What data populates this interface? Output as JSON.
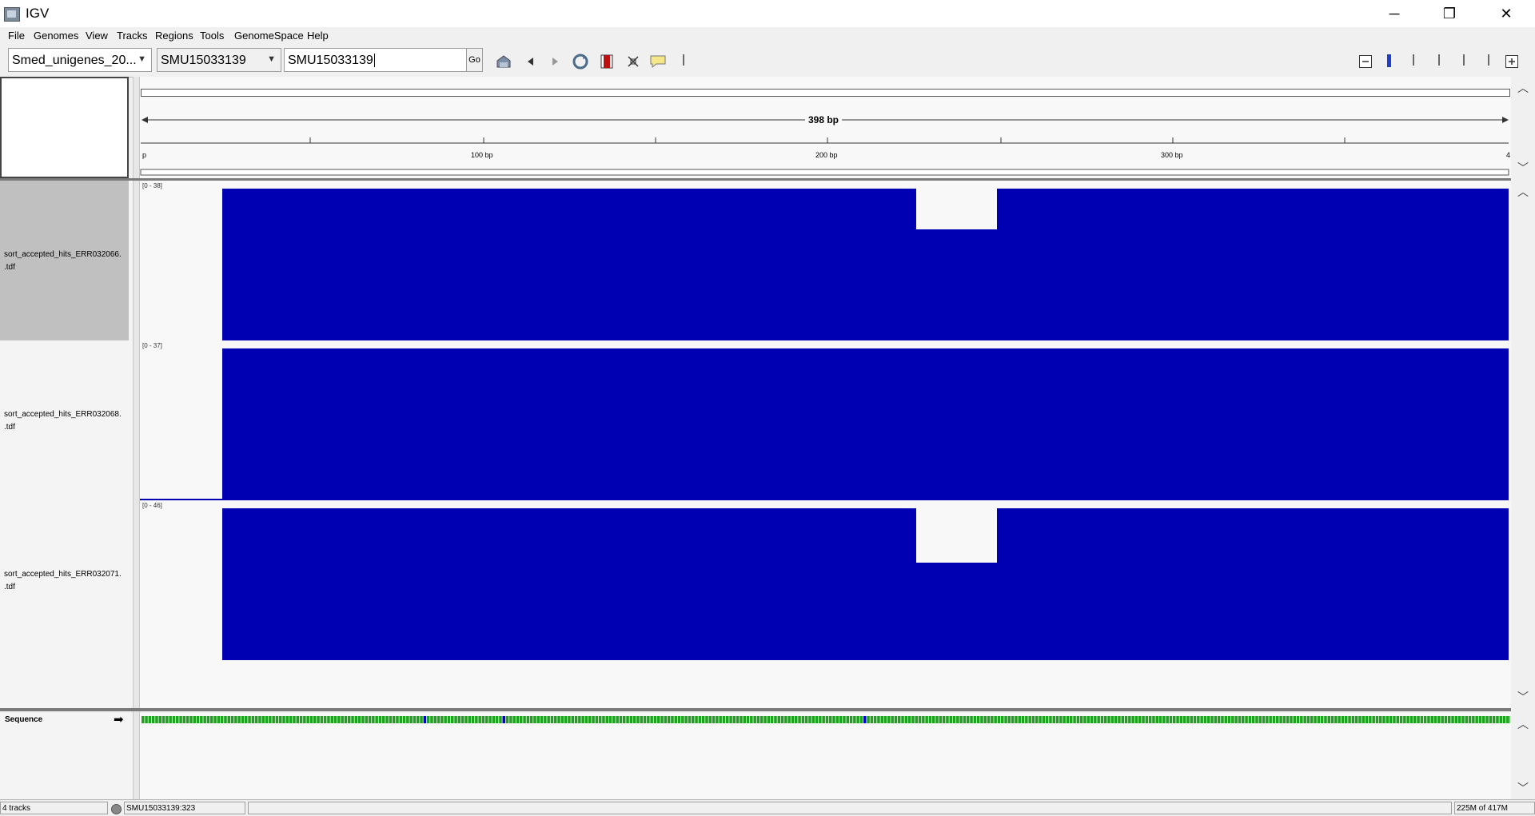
{
  "window": {
    "title": "IGV",
    "minimize": "─",
    "restore": "❐",
    "close": "✕"
  },
  "menu": [
    "File",
    "Genomes",
    "View",
    "Tracks",
    "Regions",
    "Tools",
    "GenomeSpace",
    "Help"
  ],
  "toolbar": {
    "genome_value": "Smed_unigenes_20...",
    "chromosome_value": "SMU15033139",
    "locus_value": "SMU15033139",
    "go_label": "Go"
  },
  "ruler": {
    "span_label": "398 bp",
    "tick_labels": [
      "p",
      "100 bp",
      "200 bp",
      "300 bp",
      "4"
    ]
  },
  "tracks": [
    {
      "name_line1": "sort_accepted_hits_ERR032066.",
      "name_line2": ".tdf",
      "range": "[0 - 38]"
    },
    {
      "name_line1": "sort_accepted_hits_ERR032068.",
      "name_line2": ".tdf",
      "range": "[0 - 37]"
    },
    {
      "name_line1": "sort_accepted_hits_ERR032071.",
      "name_line2": ".tdf",
      "range": "[0 - 46]"
    }
  ],
  "sequence": {
    "label": "Sequence",
    "arrow": "➡"
  },
  "status": {
    "tracks": "4 tracks",
    "position": "SMU15033139:323",
    "memory": "225M of 417M"
  },
  "colors": {
    "coverage": "#0000b2",
    "selected_track": "#c0c0c0"
  },
  "icons": [
    "home-icon",
    "back-icon",
    "forward-icon",
    "refresh-icon",
    "roi-icon",
    "fit-window-icon",
    "popup-info-icon",
    "zoom-out-icon",
    "zoom-in-icon"
  ]
}
